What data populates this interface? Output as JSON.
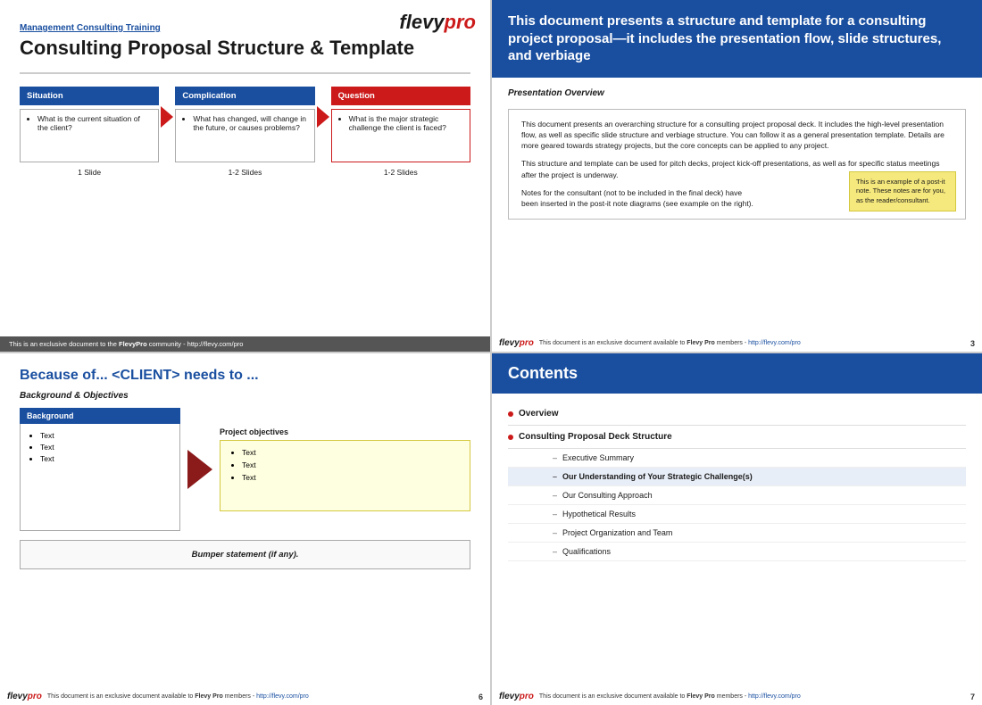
{
  "slide1": {
    "logo_flevy": "flevy",
    "logo_pro": "pro",
    "subtitle": "Management Consulting Training",
    "title": "Consulting Proposal Structure & Template",
    "flow": [
      {
        "id": "situation",
        "header": "Situation",
        "header_class": "situation",
        "body": "What is the current situation of the client?",
        "slides": "1 Slide"
      },
      {
        "id": "complication",
        "header": "Complication",
        "header_class": "complication",
        "body": "What has changed, will change in the future, or causes problems?",
        "slides": "1-2 Slides"
      },
      {
        "id": "question",
        "header": "Question",
        "header_class": "question",
        "body": "What is the major strategic challenge the client is faced?",
        "slides": "1-2 Slides"
      }
    ],
    "footer": "This is an exclusive document to the FlevyPro community - http://flevy.com/pro"
  },
  "slide2": {
    "header_title": "This document presents a structure and template for a consulting project proposal—it includes the presentation flow, slide structures, and verbiage",
    "section_title": "Presentation Overview",
    "para1": "This document presents an overarching structure for a consulting project proposal deck.  It includes the high-level presentation flow, as well as specific slide structure and verbiage structure.  You can follow it as a general presentation template.  Details are more geared towards strategy projects, but the core concepts can be applied to any project.",
    "para2": "This structure and template can be used for pitch decks, project kick-off presentations, as well as for specific status meetings after the project is underway.",
    "para3": "Notes for the consultant (not to be included in the final deck) have been inserted in the post-it note diagrams (see example on the right).",
    "post_it": "This is an example of a post-it note.  These notes are for you, as the reader/consultant.",
    "footer": "This document is an exclusive document available to Flevy Pro members - http://flevy.com/pro",
    "page_num": "3"
  },
  "slide3": {
    "title": "Because of... <CLIENT> needs to ...",
    "section_title": "Background & Objectives",
    "bg_header": "Background",
    "bg_items": [
      "Text",
      "Text",
      "Text"
    ],
    "objectives_label": "Project objectives",
    "objectives_items": [
      "Text",
      "Text",
      "Text"
    ],
    "bumper": "Bumper statement (if any).",
    "footer": "This document is an exclusive document available to Flevy Pro members - http://flevy.com/pro",
    "page_num": "6"
  },
  "slide4": {
    "header_title": "Contents",
    "toc": [
      {
        "type": "top",
        "label": "Overview"
      },
      {
        "type": "top",
        "label": "Consulting Proposal Deck Structure"
      },
      {
        "type": "sub",
        "label": "Executive Summary",
        "highlighted": false
      },
      {
        "type": "sub",
        "label": "Our Understanding of Your Strategic Challenge(s)",
        "highlighted": true
      },
      {
        "type": "sub",
        "label": "Our Consulting Approach",
        "highlighted": false
      },
      {
        "type": "sub",
        "label": "Hypothetical Results",
        "highlighted": false
      },
      {
        "type": "sub",
        "label": "Project Organization and Team",
        "highlighted": false
      },
      {
        "type": "sub",
        "label": "Qualifications",
        "highlighted": false
      }
    ],
    "footer": "This document is an exclusive document available to Flevy Pro members - http://flevy.com/pro",
    "page_num": "7"
  },
  "shared": {
    "flevy_label": "flevy",
    "pro_label": "pro",
    "footer_text": "This document is an exclusive document available to Flevy Pro members - ",
    "footer_link": "http://flevy.com/pro"
  }
}
